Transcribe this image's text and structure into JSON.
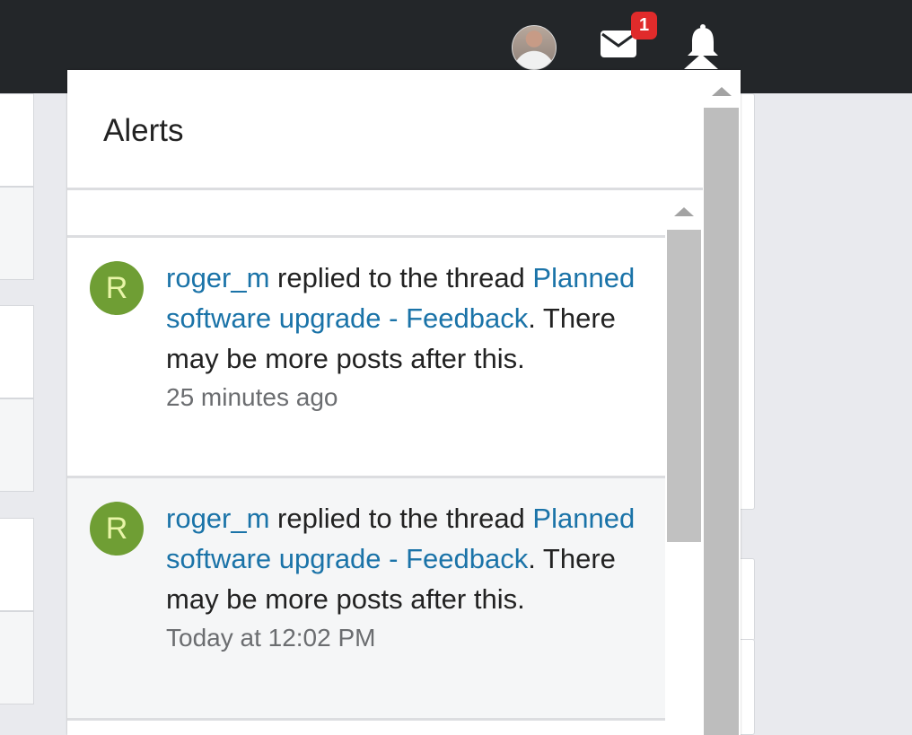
{
  "header": {
    "mail_badge_count": "1",
    "icons": [
      "user-avatar",
      "envelope-icon",
      "bell-icon"
    ]
  },
  "popup": {
    "title": "Alerts",
    "alerts": [
      {
        "avatar_letter": "R",
        "user": "roger_m",
        "action": " replied to the thread ",
        "thread": "Planned software upgrade - Feedback",
        "suffix": ". There may be more posts after this.",
        "time": "25 minutes ago",
        "state": "unread"
      },
      {
        "avatar_letter": "R",
        "user": "roger_m",
        "action": " replied to the thread ",
        "thread": "Planned software upgrade - Feedback",
        "suffix": ". There may be more posts after this.",
        "time": "Today at 12:02 PM",
        "state": "read"
      }
    ]
  },
  "colors": {
    "topbar": "#232629",
    "link": "#1a73a8",
    "avatar_bg": "#6f9e34",
    "badge": "#e02b2b"
  }
}
